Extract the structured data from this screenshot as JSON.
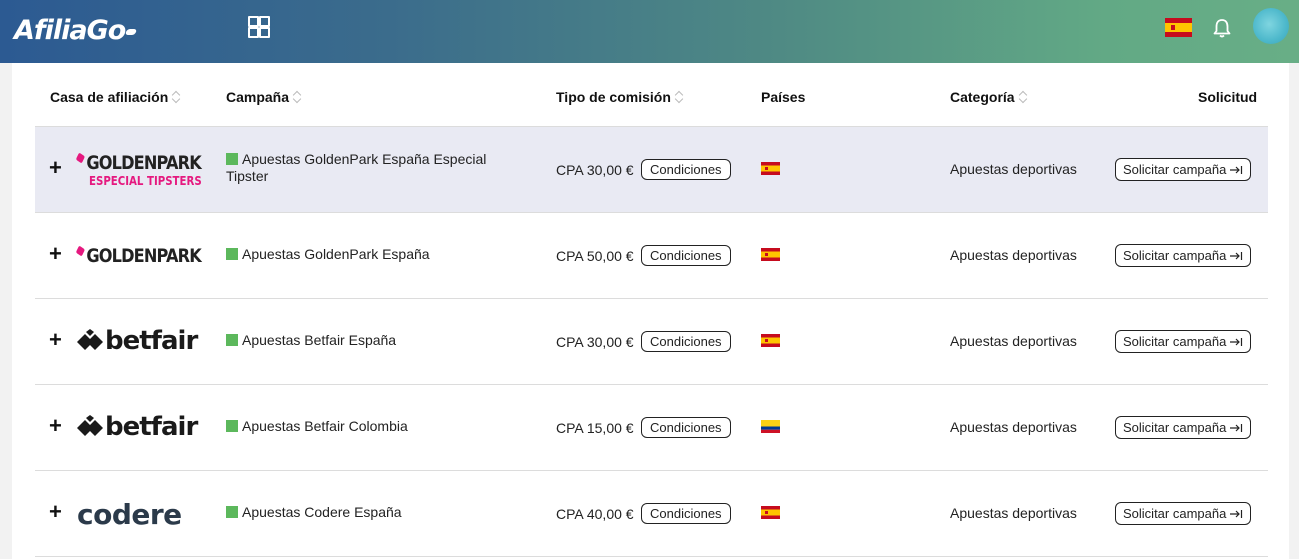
{
  "header": {
    "logo_text": "AfiliaGo",
    "apps_icon": "grid-icon",
    "language_flag": "spain-flag-icon",
    "notifications_icon": "bell-icon",
    "avatar_icon": "user-avatar"
  },
  "table": {
    "columns": {
      "casa": "Casa de afiliación",
      "campana": "Campaña",
      "tipo": "Tipo de comisión",
      "paises": "Países",
      "categoria": "Categoría",
      "solicitud": "Solicitud"
    },
    "rows": [
      {
        "brand": "GOLDENPARK",
        "brand_sub": "ESPECIAL TIPSTERS",
        "campaign": "Apuestas GoldenPark España Especial Tipster",
        "commission": "CPA 30,00 €",
        "conditions": "Condiciones",
        "country_flag": "spain",
        "category": "Apuestas deportivas",
        "request": "Solicitar campaña"
      },
      {
        "brand": "GOLDENPARK",
        "brand_sub": "",
        "campaign": "Apuestas GoldenPark España",
        "commission": "CPA 50,00 €",
        "conditions": "Condiciones",
        "country_flag": "spain",
        "category": "Apuestas deportivas",
        "request": "Solicitar campaña"
      },
      {
        "brand": "betfair",
        "brand_sub": "",
        "campaign": "Apuestas Betfair España",
        "commission": "CPA 30,00 €",
        "conditions": "Condiciones",
        "country_flag": "spain",
        "category": "Apuestas deportivas",
        "request": "Solicitar campaña"
      },
      {
        "brand": "betfair",
        "brand_sub": "",
        "campaign": "Apuestas Betfair Colombia",
        "commission": "CPA 15,00 €",
        "conditions": "Condiciones",
        "country_flag": "colombia",
        "category": "Apuestas deportivas",
        "request": "Solicitar campaña"
      },
      {
        "brand": "codere",
        "brand_sub": "",
        "campaign": "Apuestas Codere España",
        "commission": "CPA 40,00 €",
        "conditions": "Condiciones",
        "country_flag": "spain",
        "category": "Apuestas deportivas",
        "request": "Solicitar campaña"
      }
    ],
    "expand_symbol": "+"
  },
  "colors": {
    "header_gradient_start": "#2c5a92",
    "header_gradient_end": "#68ae86",
    "status_green": "#5cb85c",
    "goldenpark_pink": "#e5197f",
    "highlight_row": "#e9eaf3"
  }
}
